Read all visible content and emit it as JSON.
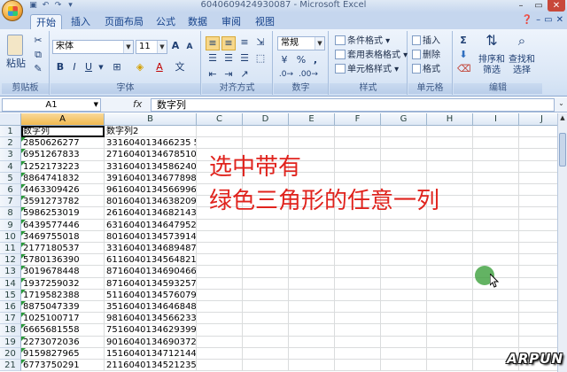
{
  "window": {
    "title": "6040609424930087 - Microsoft Excel",
    "minimize": "–",
    "restore": "▭",
    "close": "✕"
  },
  "tabs": [
    "开始",
    "插入",
    "页面布局",
    "公式",
    "数据",
    "审阅",
    "视图"
  ],
  "ribbon": {
    "clipboard": {
      "label": "剪贴板",
      "paste": "粘贴"
    },
    "font": {
      "label": "字体",
      "name": "宋体",
      "size": "11",
      "bold": "B",
      "italic": "I",
      "underline": "U",
      "grow": "A",
      "shrink": "A",
      "font_color_glyph": "A",
      "wen": "文"
    },
    "alignment": {
      "label": "对齐方式"
    },
    "number": {
      "label": "数字",
      "format": "常规",
      "percent": "%",
      "comma": ","
    },
    "styles": {
      "label": "样式",
      "conditional": "条件格式",
      "table": "套用表格格式",
      "cell_styles": "单元格样式"
    },
    "cells": {
      "label": "单元格",
      "insert": "插入",
      "delete": "删除",
      "format": "格式"
    },
    "editing": {
      "label": "编辑",
      "sigma": "Σ",
      "sort": "排序和",
      "sort2": "筛选",
      "find": "查找和",
      "find2": "选择"
    }
  },
  "formula_bar": {
    "name_box": "A1",
    "fx": "fx",
    "value": "数字列"
  },
  "columns": [
    "A",
    "B",
    "C",
    "D",
    "E",
    "F",
    "G",
    "H",
    "I",
    "J"
  ],
  "rows": [
    {
      "n": "1",
      "a": "数字列",
      "b": "数字列2"
    },
    {
      "n": "2",
      "a": "2850626277",
      "b": "331604013466235 5"
    },
    {
      "n": "3",
      "a": "6951267833",
      "b": "2716040134678510"
    },
    {
      "n": "4",
      "a": "1252173223",
      "b": "3316040134586240"
    },
    {
      "n": "5",
      "a": "8864741832",
      "b": "3916040134677898"
    },
    {
      "n": "6",
      "a": "4463309426",
      "b": "9616040134566996"
    },
    {
      "n": "7",
      "a": "3591273782",
      "b": "8016040134638209"
    },
    {
      "n": "8",
      "a": "5986253019",
      "b": "2616040134682143"
    },
    {
      "n": "9",
      "a": "6439577446",
      "b": "6316040134647952"
    },
    {
      "n": "10",
      "a": "3469755018",
      "b": "8016040134573914"
    },
    {
      "n": "11",
      "a": "2177180537",
      "b": "3316040134689487"
    },
    {
      "n": "12",
      "a": "5780136390",
      "b": "6116040134564821"
    },
    {
      "n": "13",
      "a": "3019678448",
      "b": "8716040134690466"
    },
    {
      "n": "14",
      "a": "1937259032",
      "b": "8716040134593257"
    },
    {
      "n": "15",
      "a": "1719582388",
      "b": "5116040134576079"
    },
    {
      "n": "16",
      "a": "8875047339",
      "b": "3516040134646848"
    },
    {
      "n": "17",
      "a": "1025100717",
      "b": "9816040134566233"
    },
    {
      "n": "18",
      "a": "6665681558",
      "b": "7516040134629399"
    },
    {
      "n": "19",
      "a": "2273072036",
      "b": "9016040134690372"
    },
    {
      "n": "20",
      "a": "9159827965",
      "b": "1516040134712144"
    },
    {
      "n": "21",
      "a": "6773750291",
      "b": "2116040134521235"
    }
  ],
  "annotation": {
    "line1": "选中带有",
    "line2": "绿色三角形的任意一列"
  },
  "watermark": "ARPUN",
  "colors": {
    "annotation": "#e0231d",
    "error_triangle": "#2a9a3a",
    "selected_header": "#f1b94f"
  }
}
